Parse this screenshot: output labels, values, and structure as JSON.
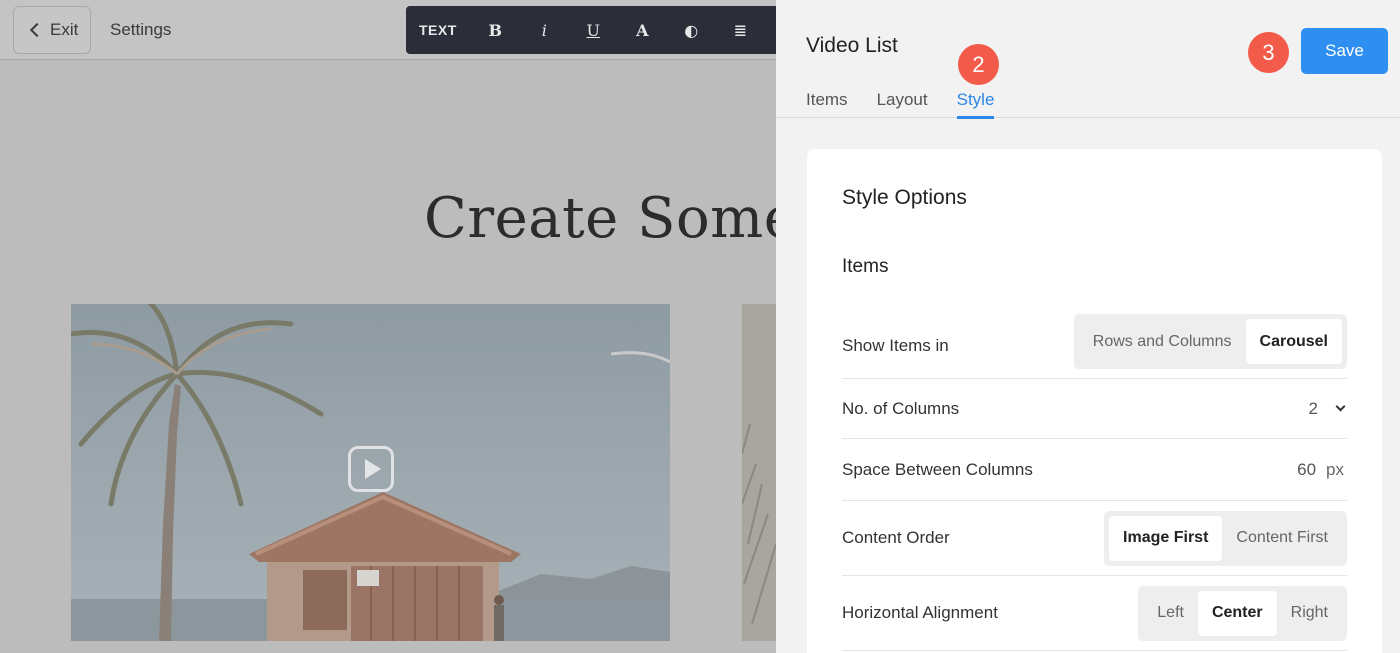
{
  "topbar": {
    "exit_label": "Exit",
    "settings_label": "Settings"
  },
  "text_toolbar": {
    "label": "TEXT",
    "buttons": [
      {
        "name": "bold",
        "glyph": "B"
      },
      {
        "name": "italic",
        "glyph": "i"
      },
      {
        "name": "underline",
        "glyph": "U"
      },
      {
        "name": "font-color",
        "glyph": "A"
      },
      {
        "name": "contrast",
        "glyph": "◐"
      },
      {
        "name": "align",
        "glyph": "≣"
      }
    ]
  },
  "canvas": {
    "heading": "Create Someth"
  },
  "panel": {
    "title": "Video List",
    "tabs": [
      {
        "label": "Items",
        "active": false
      },
      {
        "label": "Layout",
        "active": false
      },
      {
        "label": "Style",
        "active": true
      }
    ],
    "save_label": "Save",
    "step_badges": [
      "2",
      "3"
    ],
    "accent_color": "#2d86e8",
    "badge_color": "#f25a4a"
  },
  "style_options": {
    "title": "Style Options",
    "section": "Items",
    "show_items_in": {
      "label": "Show Items in",
      "options": [
        "Rows and Columns",
        "Carousel"
      ],
      "selected": "Carousel"
    },
    "columns": {
      "label": "No. of Columns",
      "value": "2"
    },
    "space_between": {
      "label": "Space Between Columns",
      "value": "60",
      "unit": "px"
    },
    "content_order": {
      "label": "Content Order",
      "options": [
        "Image First",
        "Content First"
      ],
      "selected": "Image First"
    },
    "horizontal_alignment": {
      "label": "Horizontal Alignment",
      "options": [
        "Left",
        "Center",
        "Right"
      ],
      "selected": "Center"
    }
  }
}
